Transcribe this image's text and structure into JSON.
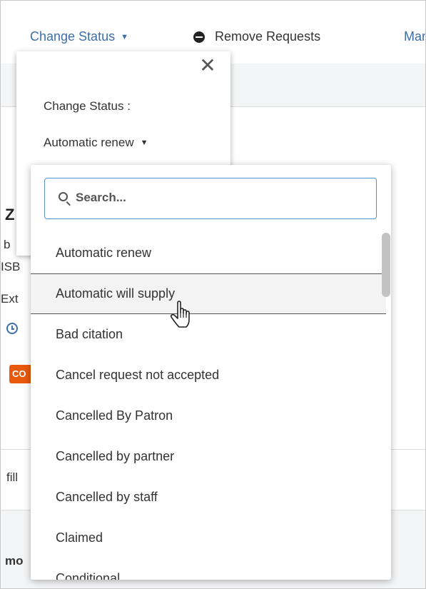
{
  "toolbar": {
    "change_status_label": "Change Status",
    "caret": "▼",
    "remove_requests_label": "Remove Requests",
    "manage_label_partial": "Man"
  },
  "background": {
    "title_fragment": "Z",
    "line1": "b",
    "line2": "ISB",
    "line3": "Ext",
    "badge": "CO",
    "fill_fragment": "fill",
    "lower_fragment": "mo"
  },
  "popover": {
    "close_glyph": "✕",
    "label": "Change Status :",
    "selected_value": "Automatic renew",
    "caret": "▼"
  },
  "dropdown": {
    "search_placeholder": "Search...",
    "options": [
      "Automatic renew",
      "Automatic will supply",
      "Bad citation",
      "Cancel request not accepted",
      "Cancelled By Patron",
      "Cancelled by partner",
      "Cancelled by staff",
      "Claimed",
      "Conditional"
    ],
    "hovered_index": 1
  },
  "colors": {
    "link_blue": "#3d6ea8",
    "badge_orange": "#e8590c",
    "search_border": "#5b8fc9"
  }
}
